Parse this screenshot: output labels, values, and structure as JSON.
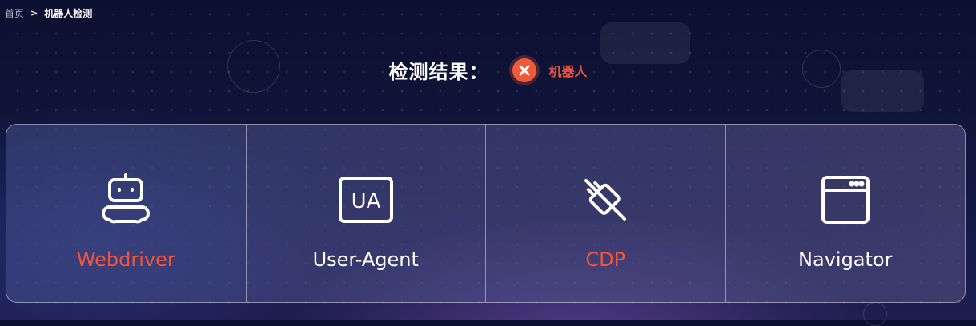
{
  "breadcrumb": {
    "home": "首页",
    "separator": ">",
    "current": "机器人检测"
  },
  "result": {
    "title": "检测结果：",
    "icon": "close-circle-icon",
    "text": "机器人",
    "color": "#f0553d"
  },
  "checks": [
    {
      "label": "Webdriver",
      "icon": "robot-icon",
      "status": "fail"
    },
    {
      "label": "User-Agent",
      "icon": "ua-icon",
      "icon_text": "UA",
      "status": "pass"
    },
    {
      "label": "CDP",
      "icon": "plug-disconnected-icon",
      "status": "fail"
    },
    {
      "label": "Navigator",
      "icon": "browser-window-icon",
      "status": "pass"
    }
  ],
  "colors": {
    "fail": "#f0553d",
    "pass": "#ffffff",
    "background": "#0b1030"
  }
}
